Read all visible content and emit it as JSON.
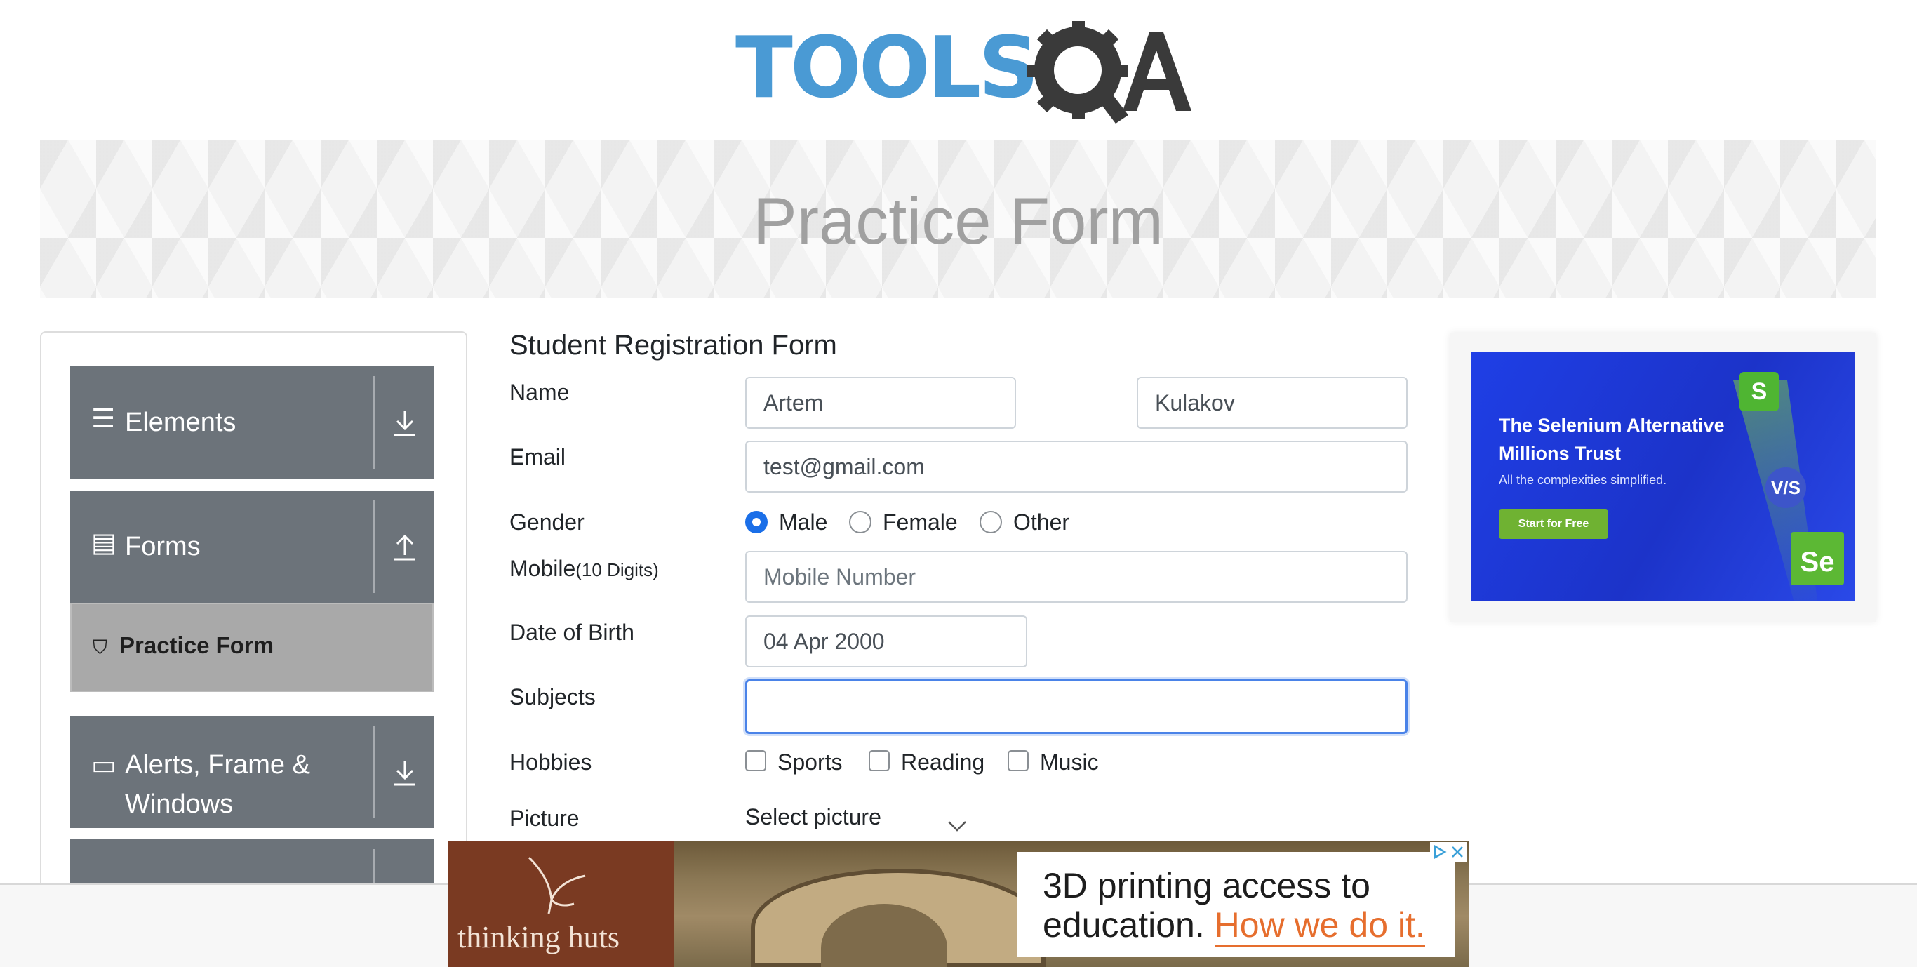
{
  "logo": {
    "text": "TOOLS",
    "text2": "QA"
  },
  "banner": {
    "title": "Practice Form"
  },
  "sidebar": {
    "groups": [
      {
        "label": "Elements",
        "icon": "menu-icon",
        "arrow": "download-arrow-icon"
      },
      {
        "label": "Forms",
        "icon": "document-icon",
        "arrow": "upload-arrow-icon"
      },
      {
        "label": "Alerts, Frame & Windows",
        "icon": "window-icon",
        "arrow": "download-arrow-icon"
      },
      {
        "label": "Widgets",
        "icon": "widget-icon",
        "arrow": "download-arrow-icon"
      }
    ],
    "active_item": {
      "label": "Practice Form",
      "icon": "html5-icon"
    }
  },
  "form": {
    "title": "Student Registration Form",
    "name_label": "Name",
    "first_name": "Artem",
    "last_name": "Kulakov",
    "email_label": "Email",
    "email": "test@gmail.com",
    "gender_label": "Gender",
    "gender_options": [
      "Male",
      "Female",
      "Other"
    ],
    "gender_selected": "Male",
    "mobile_label": "Mobile",
    "mobile_hint": "(10 Digits)",
    "mobile_placeholder": "Mobile Number",
    "dob_label": "Date of Birth",
    "dob": "04 Apr 2000",
    "subjects_label": "Subjects",
    "subjects": "",
    "hobbies_label": "Hobbies",
    "hobbies": [
      "Sports",
      "Reading",
      "Music"
    ],
    "picture_label": "Picture",
    "picture_button": "Select picture"
  },
  "ad_right": {
    "title": "The Selenium Alternative Millions Trust",
    "subtitle": "All the complexities simplified.",
    "cta": "Start for Free",
    "badge_s": "S",
    "badge_vs": "V/S",
    "badge_se": "Se"
  },
  "ad_bottom": {
    "brand": "thinking huts",
    "text": "3D printing access to education.",
    "link": "How we do it."
  },
  "colors": {
    "sidebar_group": "#6c737a",
    "active_item": "#a9a9a9",
    "radio_checked": "#1b6fe8",
    "focus_border": "#4a83e8",
    "logo_blue": "#4a9ad4",
    "logo_dark": "#3a3a3a"
  }
}
